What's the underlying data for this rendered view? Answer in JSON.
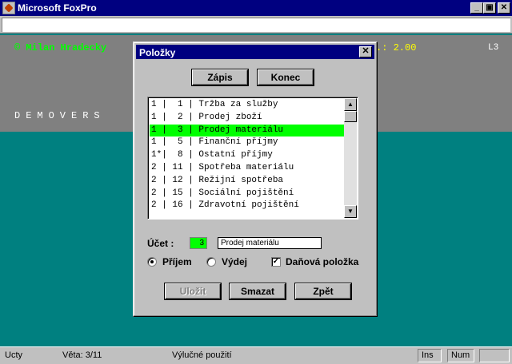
{
  "window": {
    "title": "Microsoft FoxPro",
    "minimize": "_",
    "restore": "▣",
    "close": "✕"
  },
  "desktop": {
    "author": "© Milan Hradecky",
    "version_suffix": ".: 2.00",
    "screen_code": "L3",
    "demo_banner": "DEMOVERS"
  },
  "dialog": {
    "title": "Položky",
    "close": "✕",
    "buttons": {
      "zapis": "Zápis",
      "konec": "Konec",
      "ulozit": "Uložit",
      "smazat": "Smazat",
      "zpet": "Zpět"
    },
    "list": {
      "rows": [
        "1 |  1 | Tržba za služby",
        "1 |  2 | Prodej zboží",
        "1 |  3 | Prodej materiálu",
        "1 |  5 | Finanční příjmy",
        "1*|  8 | Ostatní příjmy",
        "2 | 11 | Spotřeba materiálu",
        "2 | 12 | Režijní spotřeba",
        "2 | 15 | Sociální pojištění",
        "2 | 16 | Zdravotní pojištění"
      ],
      "selected_index": 2,
      "scroll_up": "▲",
      "scroll_down": "▼"
    },
    "ucet": {
      "label": "Účet :",
      "code": "3",
      "name": "Prodej materiálu"
    },
    "radios": {
      "prijem": "Příjem",
      "vydej": "Výdej",
      "selected": "prijem"
    },
    "checkbox": {
      "label": "Daňová položka",
      "checked": true,
      "mark": "✓"
    }
  },
  "statusbar": {
    "table": "Ucty",
    "record": "Věta: 3/11",
    "mode": "Výlučné použití",
    "ins": "Ins",
    "num": "Num"
  }
}
